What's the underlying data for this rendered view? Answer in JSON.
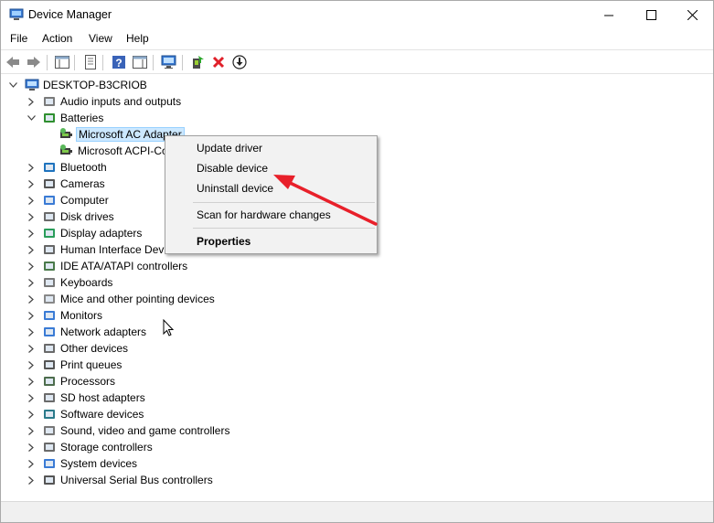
{
  "window": {
    "title": "Device Manager"
  },
  "menu": [
    "File",
    "Action",
    "View",
    "Help"
  ],
  "tree": {
    "root": "DESKTOP-B3CRIOB",
    "batteries_children": [
      "Microsoft AC Adapter",
      "Microsoft ACPI-Co"
    ],
    "categories": [
      "Audio inputs and outputs",
      "Batteries",
      "Bluetooth",
      "Cameras",
      "Computer",
      "Disk drives",
      "Display adapters",
      "Human Interface Devic",
      "IDE ATA/ATAPI controllers",
      "Keyboards",
      "Mice and other pointing devices",
      "Monitors",
      "Network adapters",
      "Other devices",
      "Print queues",
      "Processors",
      "SD host adapters",
      "Software devices",
      "Sound, video and game controllers",
      "Storage controllers",
      "System devices",
      "Universal Serial Bus controllers"
    ]
  },
  "context_menu": {
    "items": [
      "Update driver",
      "Disable device",
      "Uninstall device",
      "Scan for hardware changes",
      "Properties"
    ]
  },
  "colors": {
    "arrow": "#e8202a",
    "selection": "#cce8ff"
  },
  "icons": [
    "back-arrow-icon",
    "forward-arrow-icon",
    "properties-icon",
    "help-icon",
    "scan-icon",
    "monitor-icon",
    "update-driver-icon",
    "uninstall-icon",
    "download-icon"
  ]
}
